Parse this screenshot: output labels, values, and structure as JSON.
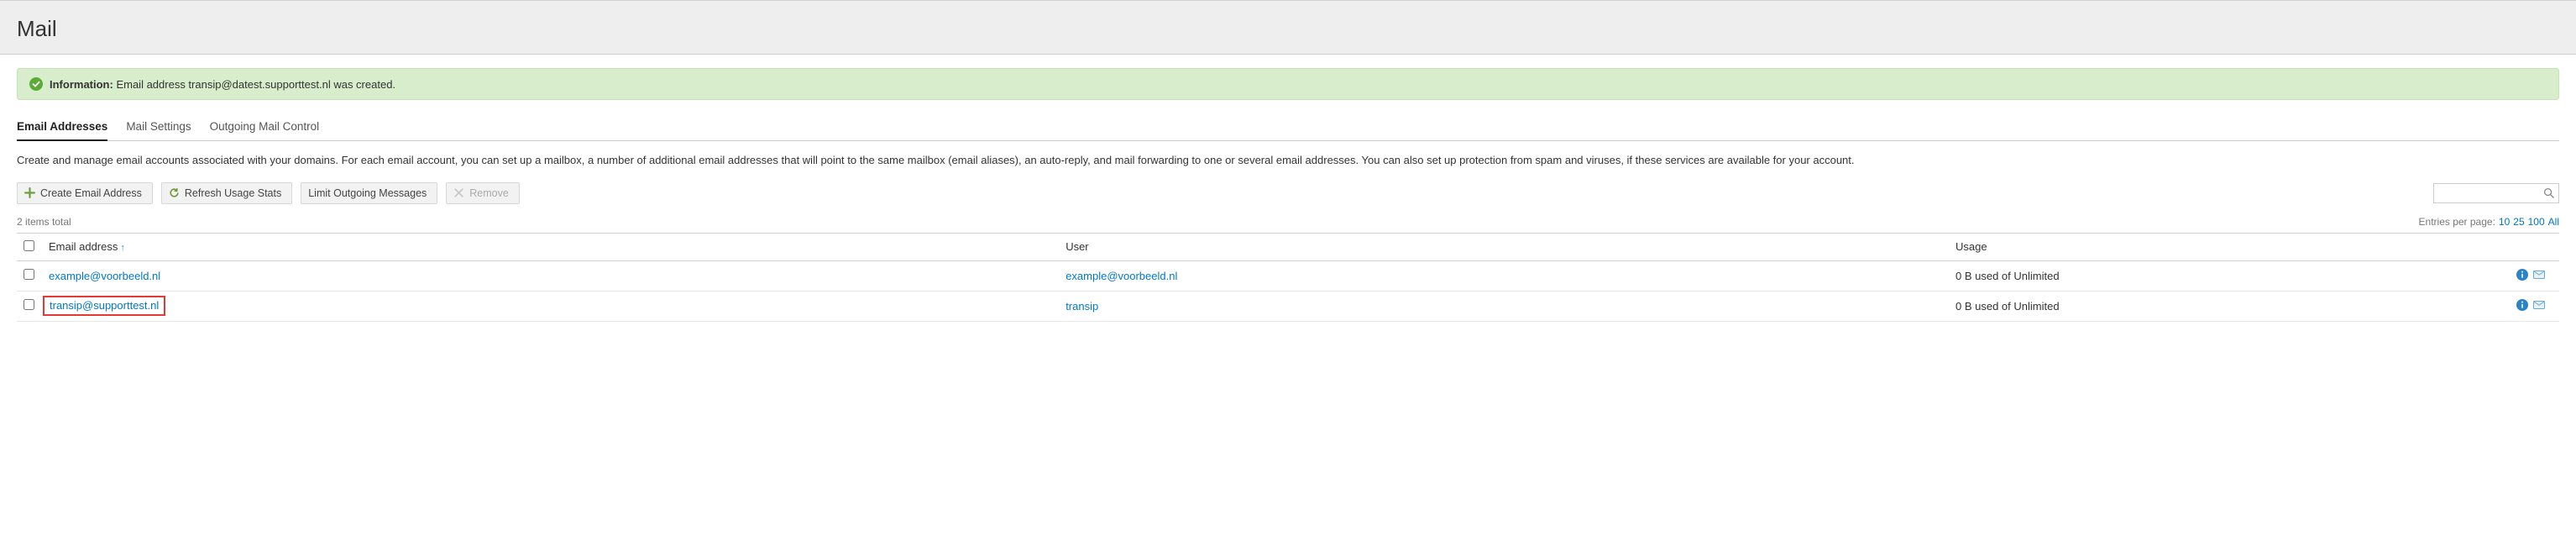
{
  "page": {
    "title": "Mail"
  },
  "banner": {
    "label": "Information:",
    "text": "Email address transip@datest.supporttest.nl was created."
  },
  "tabs": [
    {
      "id": "addresses",
      "label": "Email Addresses",
      "active": true
    },
    {
      "id": "settings",
      "label": "Mail Settings",
      "active": false
    },
    {
      "id": "outgoing",
      "label": "Outgoing Mail Control",
      "active": false
    }
  ],
  "description": "Create and manage email accounts associated with your domains. For each email account, you can set up a mailbox, a number of additional email addresses that will point to the same mailbox (email aliases), an auto-reply, and mail forwarding to one or several email addresses. You can also set up protection from spam and viruses, if these services are available for your account.",
  "toolbar": {
    "create_label": "Create Email Address",
    "refresh_label": "Refresh Usage Stats",
    "limit_label": "Limit Outgoing Messages",
    "remove_label": "Remove",
    "search_placeholder": ""
  },
  "meta": {
    "total_text": "2 items total",
    "entries_label": "Entries per page:",
    "entries_options": [
      "10",
      "25",
      "100",
      "All"
    ]
  },
  "columns": {
    "email": "Email address",
    "sort_indicator": "↑",
    "user": "User",
    "usage": "Usage"
  },
  "rows": [
    {
      "email": "example@voorbeeld.nl",
      "user": "example@voorbeeld.nl",
      "usage": "0 B used of Unlimited",
      "highlight": false
    },
    {
      "email": "transip@supporttest.nl",
      "user": "transip",
      "usage": "0 B used of Unlimited",
      "highlight": true
    }
  ],
  "icons": {
    "info": "info-icon",
    "webmail": "webmail-icon"
  }
}
